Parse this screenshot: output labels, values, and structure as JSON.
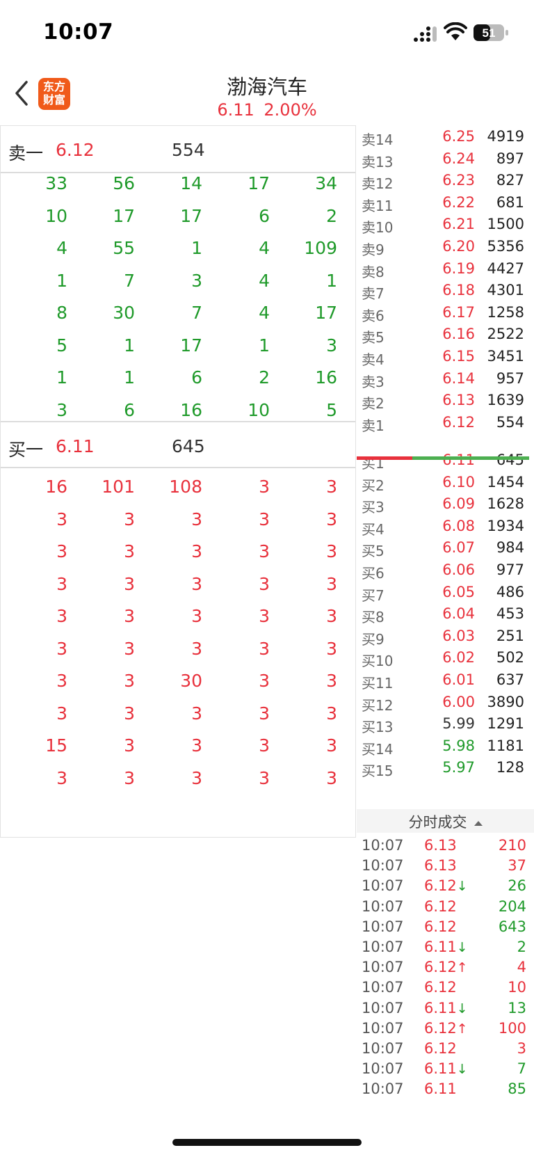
{
  "status": {
    "time": "10:07",
    "battery": "51"
  },
  "header": {
    "logo_line1": "东方",
    "logo_line2": "财富",
    "title": "渤海汽车",
    "price": "6.11",
    "change": "2.00%"
  },
  "left": {
    "sell_level": {
      "label": "卖一",
      "price": "6.12",
      "volume": "554"
    },
    "sell_orders": [
      [
        "33",
        "56",
        "14",
        "17",
        "34"
      ],
      [
        "10",
        "17",
        "17",
        "6",
        "2"
      ],
      [
        "4",
        "55",
        "1",
        "4",
        "109"
      ],
      [
        "1",
        "7",
        "3",
        "4",
        "1"
      ],
      [
        "8",
        "30",
        "7",
        "4",
        "17"
      ],
      [
        "5",
        "1",
        "17",
        "1",
        "3"
      ],
      [
        "1",
        "1",
        "6",
        "2",
        "16"
      ],
      [
        "3",
        "6",
        "16",
        "10",
        "5"
      ]
    ],
    "buy_level": {
      "label": "买一",
      "price": "6.11",
      "volume": "645"
    },
    "buy_orders": [
      [
        "16",
        "101",
        "108",
        "3",
        "3"
      ],
      [
        "3",
        "3",
        "3",
        "3",
        "3"
      ],
      [
        "3",
        "3",
        "3",
        "3",
        "3"
      ],
      [
        "3",
        "3",
        "3",
        "3",
        "3"
      ],
      [
        "3",
        "3",
        "3",
        "3",
        "3"
      ],
      [
        "3",
        "3",
        "3",
        "3",
        "3"
      ],
      [
        "3",
        "3",
        "30",
        "3",
        "3"
      ],
      [
        "3",
        "3",
        "3",
        "3",
        "3"
      ],
      [
        "15",
        "3",
        "3",
        "3",
        "3"
      ],
      [
        "3",
        "3",
        "3",
        "3",
        "3"
      ]
    ]
  },
  "orderbook": {
    "asks": [
      {
        "label": "卖14",
        "price": "6.25",
        "vol": "4919"
      },
      {
        "label": "卖13",
        "price": "6.24",
        "vol": "897"
      },
      {
        "label": "卖12",
        "price": "6.23",
        "vol": "827"
      },
      {
        "label": "卖11",
        "price": "6.22",
        "vol": "681"
      },
      {
        "label": "卖10",
        "price": "6.21",
        "vol": "1500"
      },
      {
        "label": "卖9",
        "price": "6.20",
        "vol": "5356"
      },
      {
        "label": "卖8",
        "price": "6.19",
        "vol": "4427"
      },
      {
        "label": "卖7",
        "price": "6.18",
        "vol": "4301"
      },
      {
        "label": "卖6",
        "price": "6.17",
        "vol": "1258"
      },
      {
        "label": "卖5",
        "price": "6.16",
        "vol": "2522"
      },
      {
        "label": "卖4",
        "price": "6.15",
        "vol": "3451"
      },
      {
        "label": "卖3",
        "price": "6.14",
        "vol": "957"
      },
      {
        "label": "卖2",
        "price": "6.13",
        "vol": "1639"
      },
      {
        "label": "卖1",
        "price": "6.12",
        "vol": "554"
      }
    ],
    "bids": [
      {
        "label": "买1",
        "price": "6.11",
        "vol": "645",
        "color": "red"
      },
      {
        "label": "买2",
        "price": "6.10",
        "vol": "1454",
        "color": "red"
      },
      {
        "label": "买3",
        "price": "6.09",
        "vol": "1628",
        "color": "red"
      },
      {
        "label": "买4",
        "price": "6.08",
        "vol": "1934",
        "color": "red"
      },
      {
        "label": "买5",
        "price": "6.07",
        "vol": "984",
        "color": "red"
      },
      {
        "label": "买6",
        "price": "6.06",
        "vol": "977",
        "color": "red"
      },
      {
        "label": "买7",
        "price": "6.05",
        "vol": "486",
        "color": "red"
      },
      {
        "label": "买8",
        "price": "6.04",
        "vol": "453",
        "color": "red"
      },
      {
        "label": "买9",
        "price": "6.03",
        "vol": "251",
        "color": "red"
      },
      {
        "label": "买10",
        "price": "6.02",
        "vol": "502",
        "color": "red"
      },
      {
        "label": "买11",
        "price": "6.01",
        "vol": "637",
        "color": "red"
      },
      {
        "label": "买12",
        "price": "6.00",
        "vol": "3890",
        "color": "red"
      },
      {
        "label": "买13",
        "price": "5.99",
        "vol": "1291",
        "color": "black"
      },
      {
        "label": "买14",
        "price": "5.98",
        "vol": "1181",
        "color": "green"
      },
      {
        "label": "买15",
        "price": "5.97",
        "vol": "128",
        "color": "green"
      }
    ]
  },
  "ticks_header": "分时成交",
  "ticks": [
    {
      "time": "10:07",
      "price": "6.13",
      "arrow": "",
      "vol": "210",
      "vol_color": "red"
    },
    {
      "time": "10:07",
      "price": "6.13",
      "arrow": "",
      "vol": "37",
      "vol_color": "red"
    },
    {
      "time": "10:07",
      "price": "6.12",
      "arrow": "↓",
      "vol": "26",
      "vol_color": "green"
    },
    {
      "time": "10:07",
      "price": "6.12",
      "arrow": "",
      "vol": "204",
      "vol_color": "green"
    },
    {
      "time": "10:07",
      "price": "6.12",
      "arrow": "",
      "vol": "643",
      "vol_color": "green"
    },
    {
      "time": "10:07",
      "price": "6.11",
      "arrow": "↓",
      "vol": "2",
      "vol_color": "green"
    },
    {
      "time": "10:07",
      "price": "6.12",
      "arrow": "↑",
      "vol": "4",
      "vol_color": "red"
    },
    {
      "time": "10:07",
      "price": "6.12",
      "arrow": "",
      "vol": "10",
      "vol_color": "red"
    },
    {
      "time": "10:07",
      "price": "6.11",
      "arrow": "↓",
      "vol": "13",
      "vol_color": "green"
    },
    {
      "time": "10:07",
      "price": "6.12",
      "arrow": "↑",
      "vol": "100",
      "vol_color": "red"
    },
    {
      "time": "10:07",
      "price": "6.12",
      "arrow": "",
      "vol": "3",
      "vol_color": "red"
    },
    {
      "time": "10:07",
      "price": "6.11",
      "arrow": "↓",
      "vol": "7",
      "vol_color": "green"
    },
    {
      "time": "10:07",
      "price": "6.11",
      "arrow": "",
      "vol": "85",
      "vol_color": "green"
    }
  ]
}
